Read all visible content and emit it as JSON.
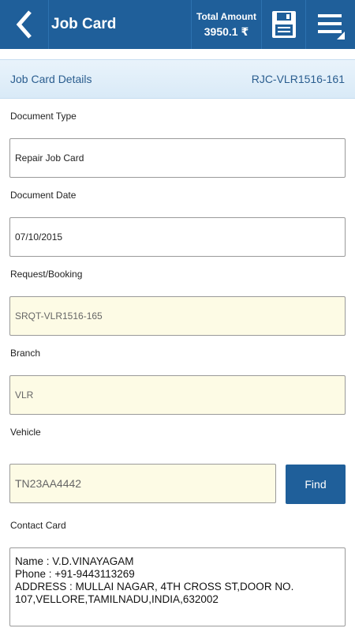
{
  "header": {
    "title": "Job Card",
    "total_label": "Total Amount",
    "total_value": "3950.1",
    "currency_symbol": "₹"
  },
  "section": {
    "title": "Job Card Details",
    "doc_number": "RJC-VLR1516-161"
  },
  "form": {
    "document_type": {
      "label": "Document Type",
      "value": "Repair Job Card"
    },
    "document_date": {
      "label": "Document Date",
      "value": "07/10/2015"
    },
    "request_booking": {
      "label": "Request/Booking",
      "value": "SRQT-VLR1516-165"
    },
    "branch": {
      "label": "Branch",
      "value": "VLR"
    },
    "vehicle": {
      "label": "Vehicle",
      "value": "TN23AA4442",
      "find_label": "Find"
    },
    "contact_card": {
      "label": "Contact Card",
      "lines": [
        "Name : V.D.VINAYAGAM",
        "Phone : +91-9443113269",
        "ADDRESS : MULLAI NAGAR, 4TH CROSS ST,DOOR NO.",
        "107,VELLORE,TAMILNADU,INDIA,632002"
      ]
    }
  },
  "colors": {
    "brand": "#1f5f9a",
    "readonly_bg": "#fdfbe5",
    "section_text": "#2a5d8f"
  },
  "icons": [
    "back-chevron-icon",
    "save-disk-icon",
    "menu-icon"
  ]
}
